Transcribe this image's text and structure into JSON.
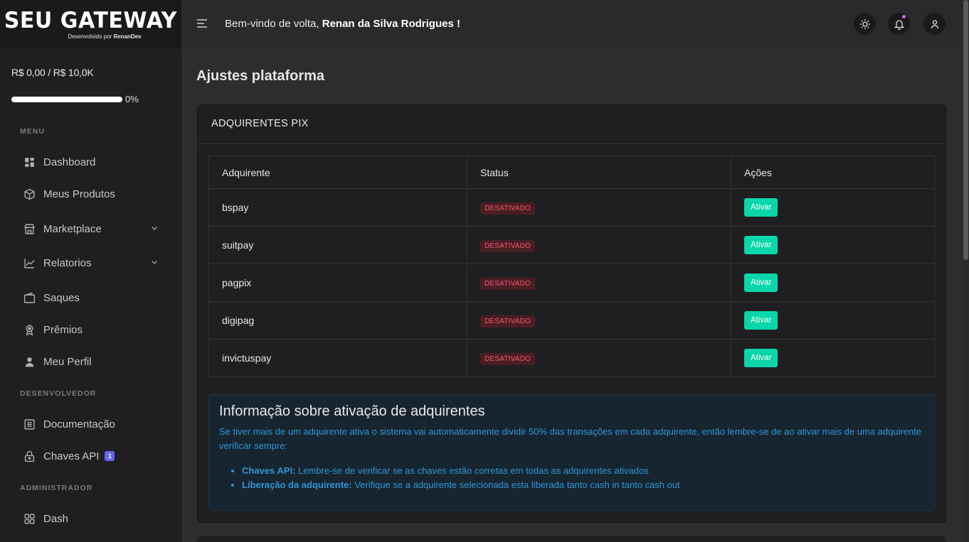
{
  "brand": {
    "name": "SEU GATEWAY",
    "sub_prefix": "Desenvolvido por",
    "sub_author": "RenanDev"
  },
  "balance": {
    "text": "R$ 0,00 / R$ 10,0K",
    "progress_label": "0%",
    "progress_fraction": 0
  },
  "sidebar": {
    "menu_label": "MENU",
    "dev_label": "DESENVOLVEDOR",
    "admin_label": "ADMINISTRADOR",
    "items": [
      {
        "label": "Dashboard",
        "icon": "dashboard-icon"
      },
      {
        "label": "Meus Produtos",
        "icon": "box-icon"
      },
      {
        "label": "Marketplace",
        "icon": "store-icon"
      },
      {
        "label": "Relatorios",
        "icon": "chart-line-icon"
      },
      {
        "label": "Saques",
        "icon": "wallet-icon"
      },
      {
        "label": "Prêmios",
        "icon": "award-icon"
      },
      {
        "label": "Meu Perfil",
        "icon": "user-icon"
      },
      {
        "label": "Documentação",
        "icon": "document-icon"
      },
      {
        "label": "Chaves API",
        "icon": "lock-icon",
        "badge": "1"
      },
      {
        "label": "Dash",
        "icon": "grid-icon"
      }
    ]
  },
  "topbar": {
    "welcome_prefix": "Bem-vindo de volta,",
    "user_name": "Renan da Silva Rodrigues !"
  },
  "page": {
    "title": "Ajustes plataforma"
  },
  "card": {
    "title": "ADQUIRENTES PIX",
    "columns": [
      "Adquirente",
      "Status",
      "Ações"
    ],
    "rows": [
      {
        "name": "bspay",
        "status": "DESATIVADO",
        "action": "Ativar"
      },
      {
        "name": "suitpay",
        "status": "DESATIVADO",
        "action": "Ativar"
      },
      {
        "name": "pagpix",
        "status": "DESATIVADO",
        "action": "Ativar"
      },
      {
        "name": "digipag",
        "status": "DESATIVADO",
        "action": "Ativar"
      },
      {
        "name": "invictuspay",
        "status": "DESATIVADO",
        "action": "Ativar"
      }
    ]
  },
  "info": {
    "title": "Informação sobre ativação de adquirentes",
    "text": "Se tiver mais de um adquirente ativa o sistema vai automaticamente dividir 50% das transações em cada adquirente, então lembre-se de ao ativar mais de uma adquirente verificar sempre:",
    "bullets": [
      {
        "label": "Chaves API:",
        "text": " Lembre-se de verificar se as chaves estão corretas em todas as adquirentes ativados"
      },
      {
        "label": "Liberação da adquirente:",
        "text": " Verifique se a adquirente selecionada esta liberada tanto cash in tanto cash out"
      }
    ]
  },
  "colors": {
    "accent": "#09d6a9",
    "danger": "#f05a6c",
    "info": "#2f96d6",
    "badge": "#6366f1"
  }
}
